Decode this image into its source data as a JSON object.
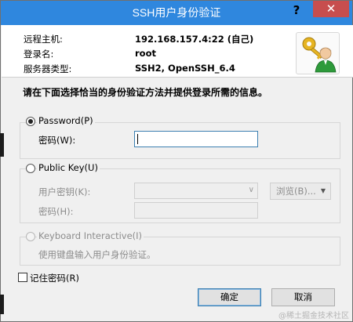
{
  "window": {
    "title": "SSH用户身份验证",
    "help_label": "?",
    "close_label": "✕"
  },
  "connection": {
    "host_label": "远程主机:",
    "host_value": "192.168.157.4:22 (自己)",
    "user_label": "登录名:",
    "user_value": "root",
    "server_label": "服务器类型:",
    "server_value": "SSH2, OpenSSH_6.4",
    "icon": "key-user-icon"
  },
  "instruction": "请在下面选择恰当的身份验证方法并提供登录所需的信息。",
  "password_group": {
    "label": "Password(P)",
    "selected": true,
    "field_label": "密码(W):",
    "field_value": ""
  },
  "publickey_group": {
    "label": "Public Key(U)",
    "selected": false,
    "key_label": "用户密钥(K):",
    "key_value": "",
    "browse_label": "浏览(B)...",
    "passphrase_label": "密码(H):",
    "passphrase_value": ""
  },
  "keyboard_group": {
    "label": "Keyboard Interactive(I)",
    "selected": false,
    "description": "使用键盘输入用户身份验证。"
  },
  "remember": {
    "label": "记住密码(R)",
    "checked": false
  },
  "buttons": {
    "ok_label": "确定",
    "cancel_label": "取消"
  },
  "watermark": "@稀土掘金技术社区",
  "colors": {
    "titlebar": "#2f87de",
    "close": "#c74e4e",
    "dialog_bg": "#f0f0f0"
  }
}
